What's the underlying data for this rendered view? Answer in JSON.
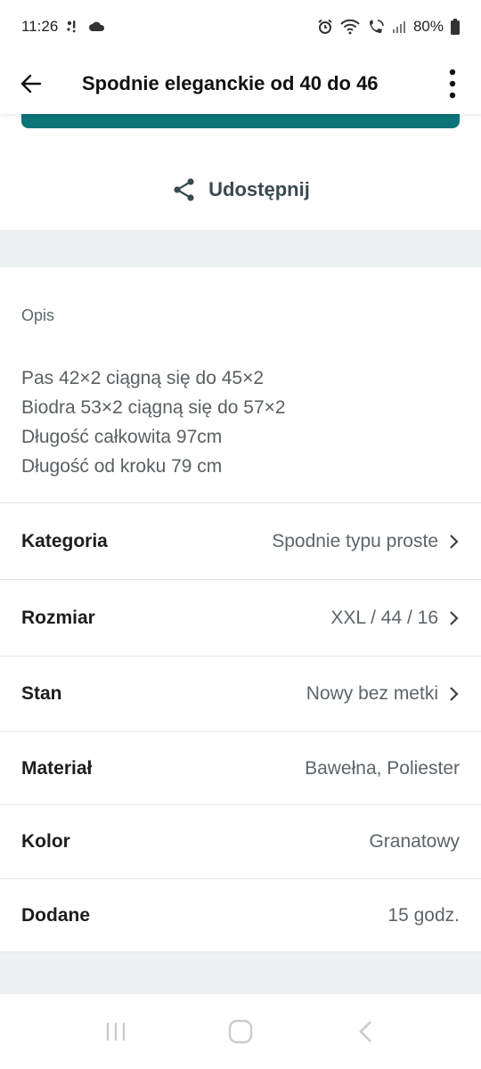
{
  "status_bar": {
    "time": "11:26",
    "battery": "80%"
  },
  "app_bar": {
    "title": "Spodnie eleganckie od 40 do 46"
  },
  "share": {
    "label": "Udostępnij"
  },
  "description": {
    "label": "Opis",
    "lines": [
      "Pas 42×2 ciągną się do 45×2",
      "Biodra 53×2 ciągną się do 57×2",
      "Długość całkowita 97cm",
      "Długość od kroku 79 cm"
    ]
  },
  "details": [
    {
      "label": "Kategoria",
      "value": "Spodnie typu proste",
      "has_chevron": true
    },
    {
      "label": "Rozmiar",
      "value": "XXL / 44 / 16",
      "has_chevron": true
    },
    {
      "label": "Stan",
      "value": "Nowy bez metki",
      "has_chevron": true
    },
    {
      "label": "Materiał",
      "value": "Bawełna, Poliester",
      "has_chevron": false
    },
    {
      "label": "Kolor",
      "value": "Granatowy",
      "has_chevron": false
    },
    {
      "label": "Dodane",
      "value": "15 godz.",
      "has_chevron": false
    }
  ],
  "icons": {
    "back": "arrow-left-icon",
    "more": "more-vertical-icon",
    "share": "share-icon",
    "chevron": "chevron-right-icon"
  },
  "colors": {
    "accent": "#0a7478",
    "band": "#eef1f1"
  }
}
